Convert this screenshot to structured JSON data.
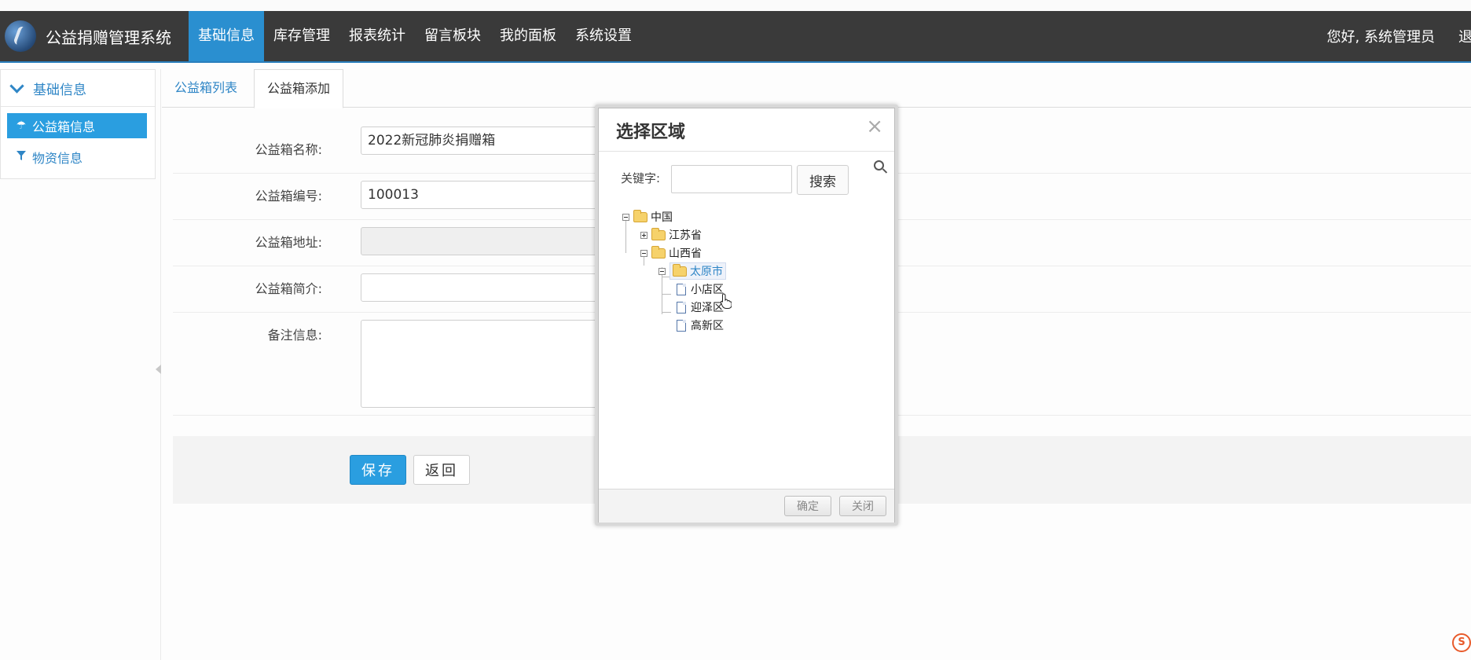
{
  "app": {
    "title": "公益捐赠管理系统"
  },
  "nav": {
    "items": [
      {
        "label": "基础信息",
        "active": true
      },
      {
        "label": "库存管理"
      },
      {
        "label": "报表统计"
      },
      {
        "label": "留言板块"
      },
      {
        "label": "我的面板"
      },
      {
        "label": "系统设置"
      }
    ],
    "greeting": "您好, 系统管理员",
    "logout": "退"
  },
  "sidebar": {
    "header": "基础信息",
    "items": [
      {
        "label": "公益箱信息",
        "icon": "umbrella-icon",
        "active": true
      },
      {
        "label": "物资信息",
        "icon": "filter-icon"
      }
    ]
  },
  "tabs": [
    {
      "label": "公益箱列表"
    },
    {
      "label": "公益箱添加",
      "active": true
    }
  ],
  "form": {
    "name_label": "公益箱名称:",
    "name_value": "2022新冠肺炎捐赠箱",
    "code_label": "公益箱编号:",
    "code_value": "100013",
    "address_label": "公益箱地址:",
    "address_value": "",
    "intro_label": "公益箱简介:",
    "intro_value": "",
    "remark_label": "备注信息:",
    "remark_value": "",
    "save_label": "保存",
    "back_label": "返回"
  },
  "dialog": {
    "title": "选择区域",
    "keyword_label": "关键字:",
    "keyword_value": "",
    "search_label": "搜索",
    "tree": {
      "root": "中国",
      "jiangsu": "江苏省",
      "shanxi": "山西省",
      "taiyuan": "太原市",
      "xiaodian": "小店区",
      "yingze": "迎泽区",
      "gaoxin": "高新区"
    },
    "ok_label": "确定",
    "close_label": "关闭"
  },
  "colors": {
    "nav_bg": "#3a3a3a",
    "accent": "#2a9ee0",
    "link": "#2f86c6"
  }
}
